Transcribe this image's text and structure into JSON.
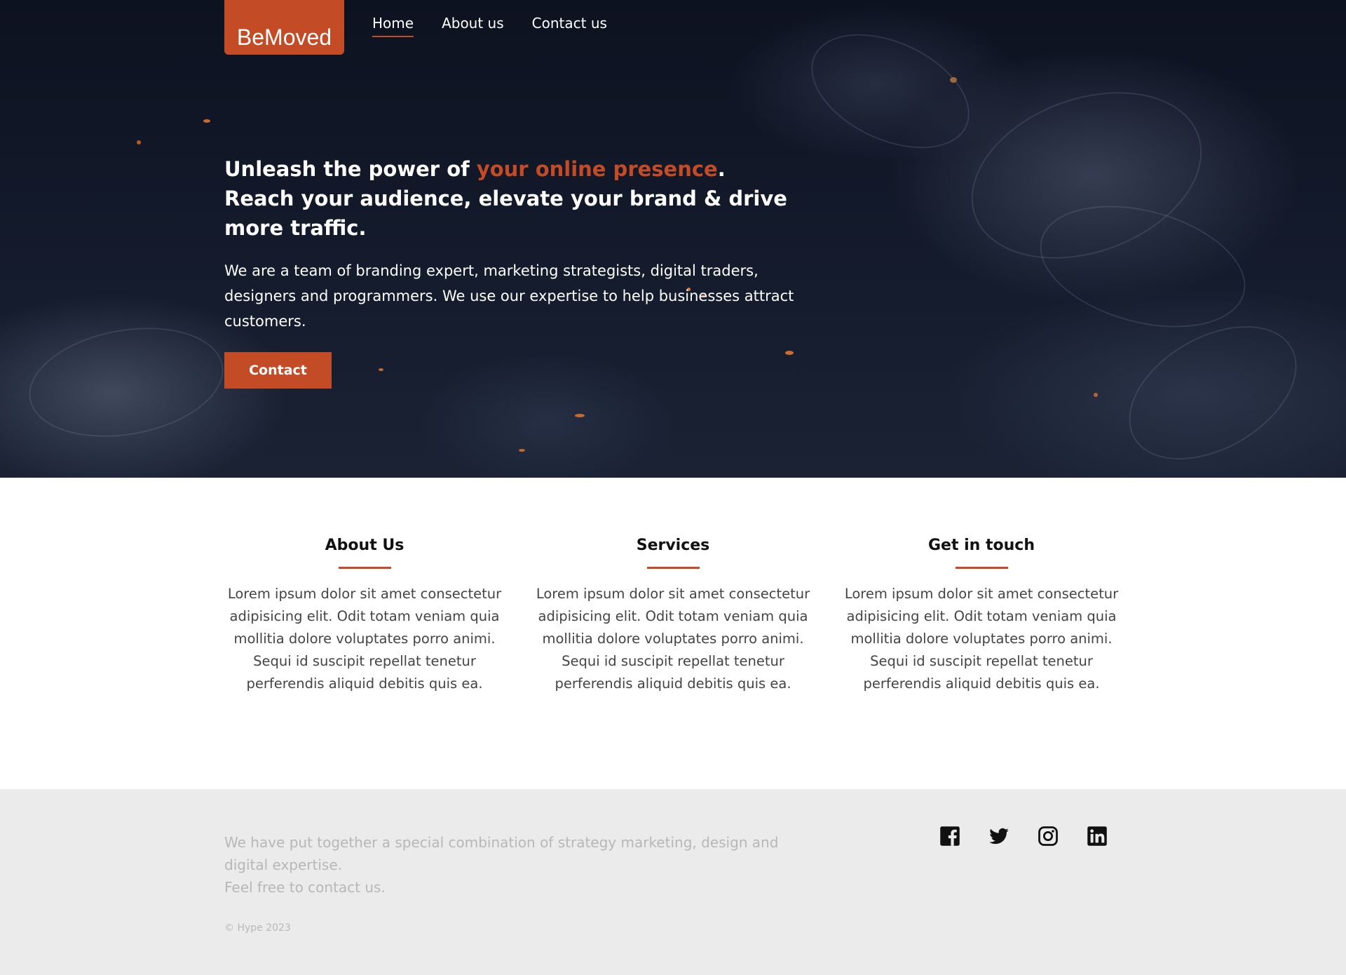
{
  "brand": {
    "name": "BeMoved",
    "accent_color": "#c34c27"
  },
  "nav": {
    "items": [
      {
        "label": "Home",
        "active": true
      },
      {
        "label": "About us",
        "active": false
      },
      {
        "label": "Contact us",
        "active": false
      }
    ]
  },
  "hero": {
    "headline_part1": "Unleash the power of ",
    "headline_accent": "your online presence",
    "headline_part2": ".",
    "headline_line2": "Reach your audience, elevate your brand & drive more traffic.",
    "lead": "We are a team of branding expert, marketing strategists, digital traders, designers and programmers. We use our expertise to help businesses attract customers.",
    "cta_label": "Contact"
  },
  "features": [
    {
      "title": "About Us",
      "body": "Lorem ipsum dolor sit amet consectetur adipisicing elit. Odit totam veniam quia mollitia dolore voluptates porro animi. Sequi id suscipit repellat tenetur perferendis aliquid debitis quis ea."
    },
    {
      "title": "Services",
      "body": "Lorem ipsum dolor sit amet consectetur adipisicing elit. Odit totam veniam quia mollitia dolore voluptates porro animi. Sequi id suscipit repellat tenetur perferendis aliquid debitis quis ea."
    },
    {
      "title": "Get in touch",
      "body": "Lorem ipsum dolor sit amet consectetur adipisicing elit. Odit totam veniam quia mollitia dolore voluptates porro animi. Sequi id suscipit repellat tenetur perferendis aliquid debitis quis ea."
    }
  ],
  "footer": {
    "text_line1": "We have put together a special combination of strategy marketing, design and digital expertise.",
    "text_line2": "Feel free to contact us.",
    "copyright": "© Hype 2023",
    "socials": [
      "facebook-icon",
      "twitter-icon",
      "instagram-icon",
      "linkedin-icon"
    ]
  }
}
